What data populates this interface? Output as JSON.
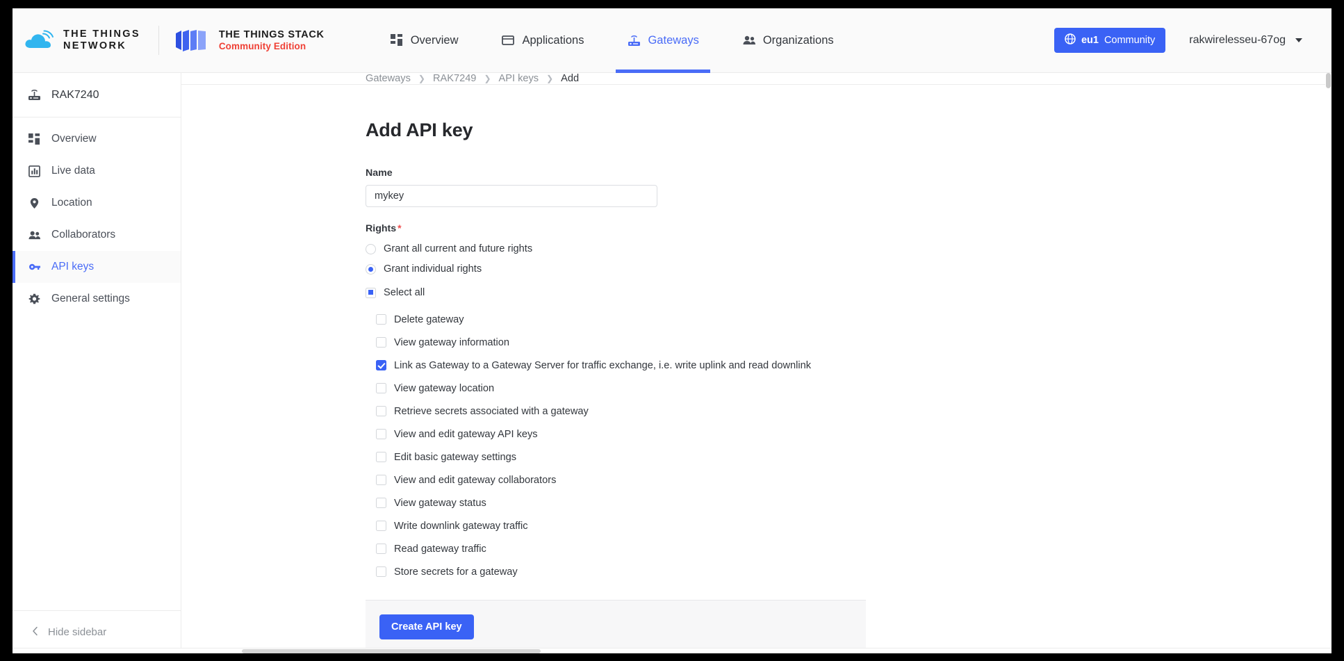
{
  "header": {
    "brand": {
      "ttn_line1": "THE THINGS",
      "ttn_line2": "NETWORK",
      "stack_line1": "THE THINGS STACK",
      "stack_line2": "Community Edition",
      "stack_accent_color": "#ef4136",
      "cloud_color": "#31b5ef"
    },
    "nav": [
      {
        "label": "Overview",
        "icon": "grid-icon",
        "active": false
      },
      {
        "label": "Applications",
        "icon": "window-icon",
        "active": false
      },
      {
        "label": "Gateways",
        "icon": "gateway-icon",
        "active": true
      },
      {
        "label": "Organizations",
        "icon": "people-icon",
        "active": false
      }
    ],
    "cluster": {
      "icon": "globe-icon",
      "code": "eu1",
      "label": "Community",
      "color": "#3a62f5"
    },
    "user": {
      "name": "rakwirelesseu-67og",
      "caret_icon": "chevron-down-icon"
    }
  },
  "sidebar": {
    "entity": {
      "label": "RAK7240",
      "icon": "gateway-icon"
    },
    "items": [
      {
        "label": "Overview",
        "icon": "grid-icon",
        "active": false
      },
      {
        "label": "Live data",
        "icon": "chart-icon",
        "active": false
      },
      {
        "label": "Location",
        "icon": "pin-icon",
        "active": false
      },
      {
        "label": "Collaborators",
        "icon": "people-icon",
        "active": false
      },
      {
        "label": "API keys",
        "icon": "key-icon",
        "active": true
      },
      {
        "label": "General settings",
        "icon": "gear-icon",
        "active": false
      }
    ],
    "footer": {
      "label": "Hide sidebar",
      "icon": "chevron-left-icon"
    }
  },
  "breadcrumb": [
    {
      "label": "Gateways",
      "last": false
    },
    {
      "label": "RAK7249",
      "last": false
    },
    {
      "label": "API keys",
      "last": false
    },
    {
      "label": "Add",
      "last": true
    }
  ],
  "page": {
    "title": "Add API key",
    "name_field": {
      "label": "Name",
      "value": "mykey",
      "placeholder": ""
    },
    "rights": {
      "label": "Rights",
      "required_marker": "*",
      "options": [
        {
          "label": "Grant all current and future rights",
          "checked": false
        },
        {
          "label": "Grant individual rights",
          "checked": true
        }
      ],
      "select_all": {
        "label": "Select all",
        "state": "indeterminate"
      },
      "permissions": [
        {
          "label": "Delete gateway",
          "checked": false
        },
        {
          "label": "View gateway information",
          "checked": false
        },
        {
          "label": "Link as Gateway to a Gateway Server for traffic exchange, i.e. write uplink and read downlink",
          "checked": true
        },
        {
          "label": "View gateway location",
          "checked": false
        },
        {
          "label": "Retrieve secrets associated with a gateway",
          "checked": false
        },
        {
          "label": "View and edit gateway API keys",
          "checked": false
        },
        {
          "label": "Edit basic gateway settings",
          "checked": false
        },
        {
          "label": "View and edit gateway collaborators",
          "checked": false
        },
        {
          "label": "View gateway status",
          "checked": false
        },
        {
          "label": "Write downlink gateway traffic",
          "checked": false
        },
        {
          "label": "Read gateway traffic",
          "checked": false
        },
        {
          "label": "Store secrets for a gateway",
          "checked": false
        }
      ]
    },
    "submit_label": "Create API key"
  }
}
